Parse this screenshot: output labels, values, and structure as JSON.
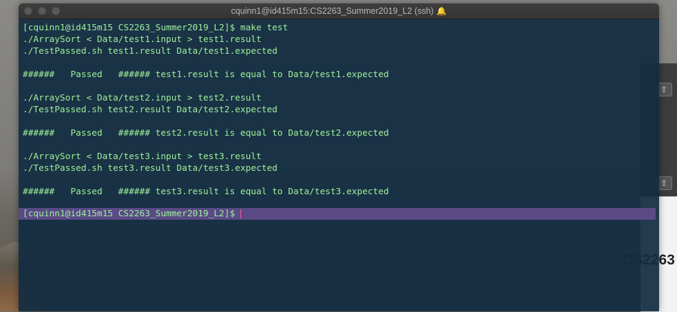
{
  "window": {
    "title": "cquinn1@id415m15:CS2263_Summer2019_L2 (ssh)",
    "bell_icon": "bell-icon"
  },
  "terminal": {
    "lines": [
      "[cquinn1@id415m15 CS2263_Summer2019_L2]$ make test",
      "./ArraySort < Data/test1.input > test1.result",
      "./TestPassed.sh test1.result Data/test1.expected",
      "",
      "######   Passed   ###### test1.result is equal to Data/test1.expected",
      "",
      "./ArraySort < Data/test2.input > test2.result",
      "./TestPassed.sh test2.result Data/test2.expected",
      "",
      "######   Passed   ###### test2.result is equal to Data/test2.expected",
      "",
      "./ArraySort < Data/test3.input > test3.result",
      "./TestPassed.sh test3.result Data/test3.expected",
      "",
      "######   Passed   ###### test3.result is equal to Data/test3.expected",
      ""
    ],
    "prompt": "[cquinn1@id415m15 CS2263_Summer2019_L2]$"
  },
  "background": {
    "doc_heading": "CS2263"
  },
  "colors": {
    "terminal_text": "#9ff29a",
    "terminal_bg": "#122c42",
    "prompt_highlight": "#5a4a86",
    "cursor": "#ff5aa0"
  }
}
